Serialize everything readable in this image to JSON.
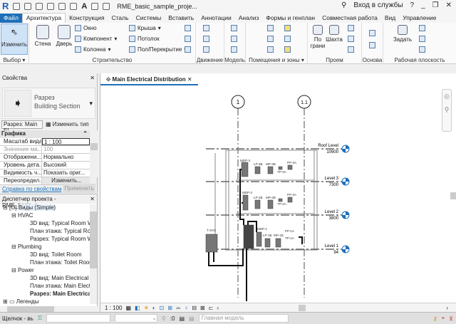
{
  "app": {
    "title": "RME_basic_sample_proje...",
    "signin": "Вход в службы"
  },
  "tabs": [
    "Файл",
    "Архитектура",
    "Конструкция",
    "Сталь",
    "Системы",
    "Вставить",
    "Аннотации",
    "Анализ",
    "Формы и генплан",
    "Совместная работа",
    "Вид",
    "Управление"
  ],
  "ribbon": {
    "modify": "Изменить",
    "select": "Выбор ▾",
    "wall": "Стена",
    "door": "Дверь",
    "window": "Окно",
    "component": "Компонент",
    "column": "Колонна",
    "roof": "Крыша",
    "ceiling": "Потолок",
    "floor": "Пол/Перекрытие",
    "build": "Строительство",
    "circulation": "Движение",
    "model": "Модель",
    "rooms": "Помещения и зоны ▾",
    "byface": "По\nграни",
    "shaft": "Шахта",
    "opening": "Проем",
    "datum": "Основа",
    "set": "Задать",
    "workplane": "Рабочая плоскость"
  },
  "properties": {
    "title": "Свойства",
    "type_name": "Разрез",
    "type_sub": "Building Section",
    "instance": "Разрез: Main El",
    "edit_type": "Изменить тип",
    "category": "Графика",
    "rows": [
      {
        "k": "Масштаб вида",
        "v": "1 : 100"
      },
      {
        "k": "Значение ма...",
        "v": "100"
      },
      {
        "k": "Отображени...",
        "v": "Нормально"
      },
      {
        "k": "Уровень дета...",
        "v": "Высокий"
      },
      {
        "k": "Видимость ч...",
        "v": "Показать ориг..."
      },
      {
        "k": "Переопредел...",
        "v": "Изменить..."
      }
    ],
    "help": "Справка по свойствам",
    "apply": "Применить"
  },
  "browser": {
    "title": "Диспетчер проекта - RME_basic_s...",
    "items": [
      "Виды (Simple)",
      "HVAC",
      "3D вид: Typical Room WS",
      "План этажа: Typical Room",
      "Разрез: Typical Room WS",
      "Plumbing",
      "3D вид: Toilet Room",
      "План этажа: Toilet Room",
      "Power",
      "3D вид: Main Electrical Di",
      "План этажа: Main Electric",
      "Разрез: Main Electrical D",
      "Легенды"
    ]
  },
  "view": {
    "tab": "Main Electrical Distribution",
    "scale": "1 : 100",
    "grids": [
      "1",
      "1.1"
    ],
    "levels": [
      {
        "name": "Roof Level",
        "elev": "10900"
      },
      {
        "name": "Level 3",
        "elev": "7300"
      },
      {
        "name": "Level 2",
        "elev": "3800"
      },
      {
        "name": "Level 1",
        "elev": "94"
      }
    ],
    "equipment": [
      "MDP-3",
      "LP-3B",
      "MP-3B",
      "TP-3A",
      "PP-3A",
      "MDP-2",
      "LP-2B",
      "MP-2B",
      "TP-2A",
      "PP-2A",
      "MDP-1",
      "LP-1B",
      "MP-1B",
      "PP-1A",
      "TP-1A",
      "T-SVC"
    ]
  },
  "status": {
    "hint": "Щелчок - вь",
    "count": ":0",
    "model": "Главная модель"
  },
  "colors": {
    "file_tab": "#1e6fb8",
    "level_marker": "#1e6fb8"
  }
}
